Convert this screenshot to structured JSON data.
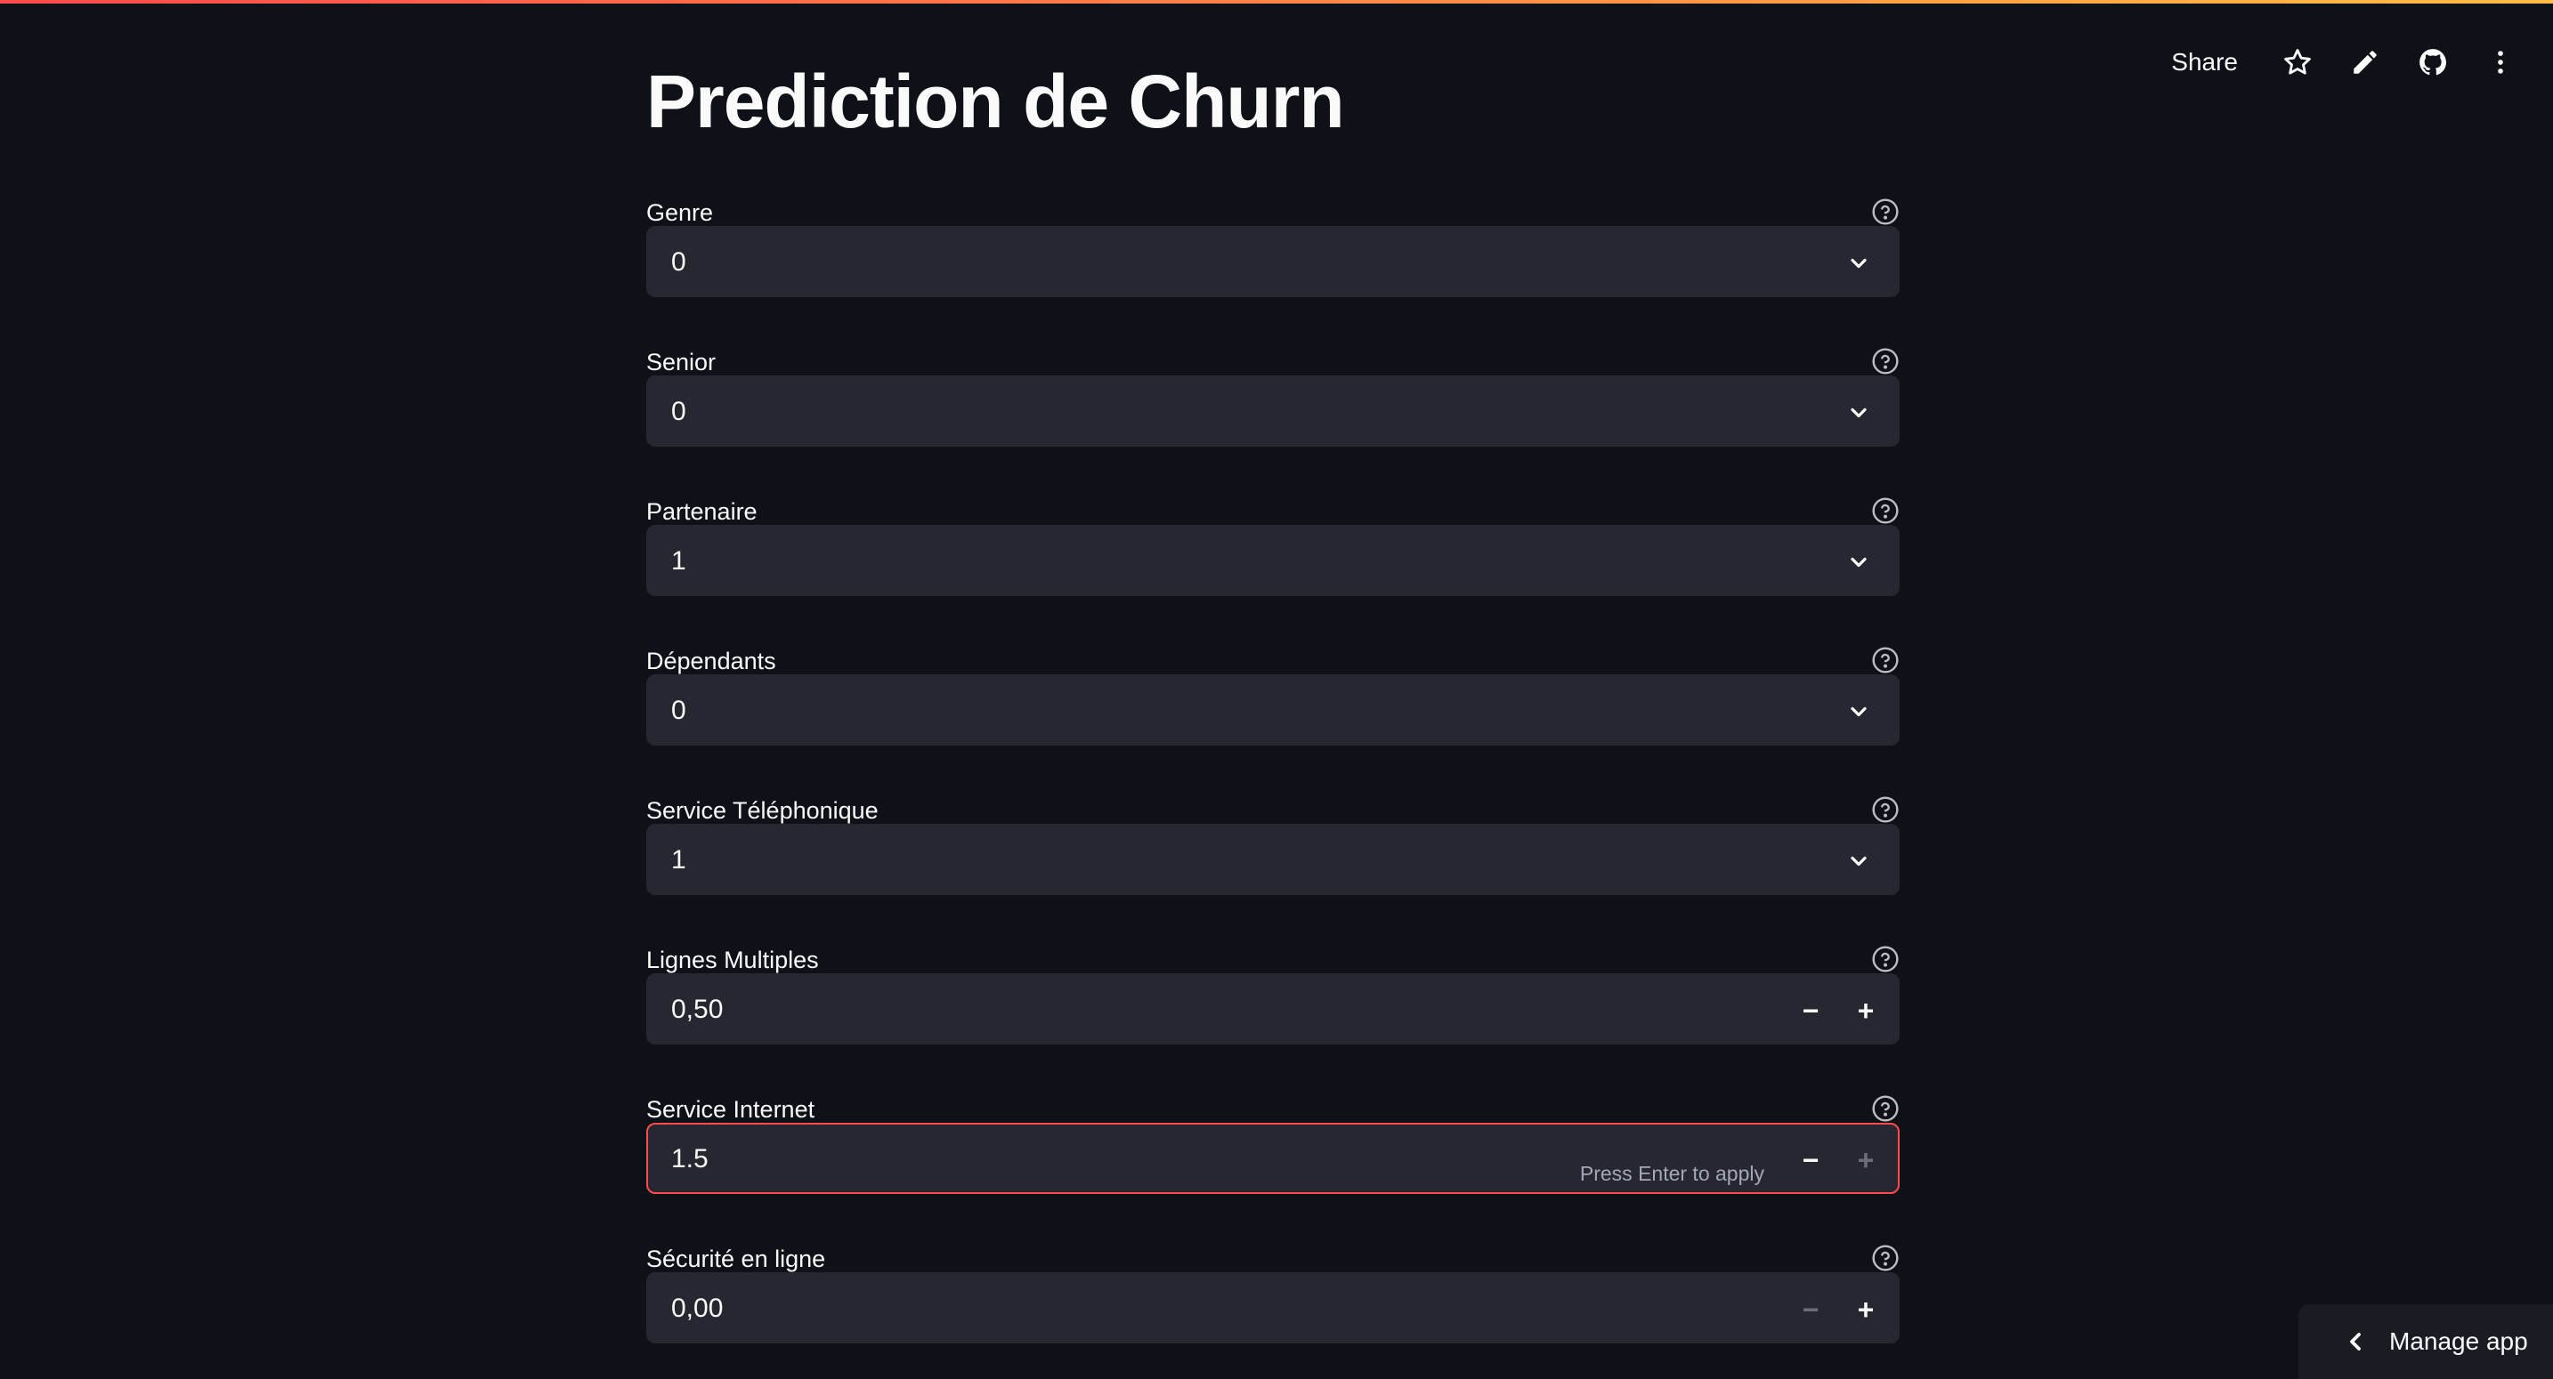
{
  "header": {
    "share_label": "Share",
    "icons": [
      "star-icon",
      "pencil-icon",
      "github-icon",
      "more-vertical-icon"
    ]
  },
  "page": {
    "title": "Prediction de Churn"
  },
  "fields": [
    {
      "label": "Genre",
      "type": "select",
      "value": "0"
    },
    {
      "label": "Senior",
      "type": "select",
      "value": "0"
    },
    {
      "label": "Partenaire",
      "type": "select",
      "value": "1"
    },
    {
      "label": "Dépendants",
      "type": "select",
      "value": "0"
    },
    {
      "label": "Service Téléphonique",
      "type": "select",
      "value": "1"
    },
    {
      "label": "Lignes Multiples",
      "type": "number",
      "value": "0,50"
    },
    {
      "label": "Service Internet",
      "type": "number",
      "value": "1.5",
      "hint": "Press Enter to apply"
    },
    {
      "label": "Sécurité en ligne",
      "type": "number",
      "value": "0,00"
    }
  ],
  "manage_app": {
    "label": "Manage app"
  },
  "colors": {
    "background": "#0e1117",
    "input_bg": "#262730",
    "accent": "#ff4b4b"
  }
}
